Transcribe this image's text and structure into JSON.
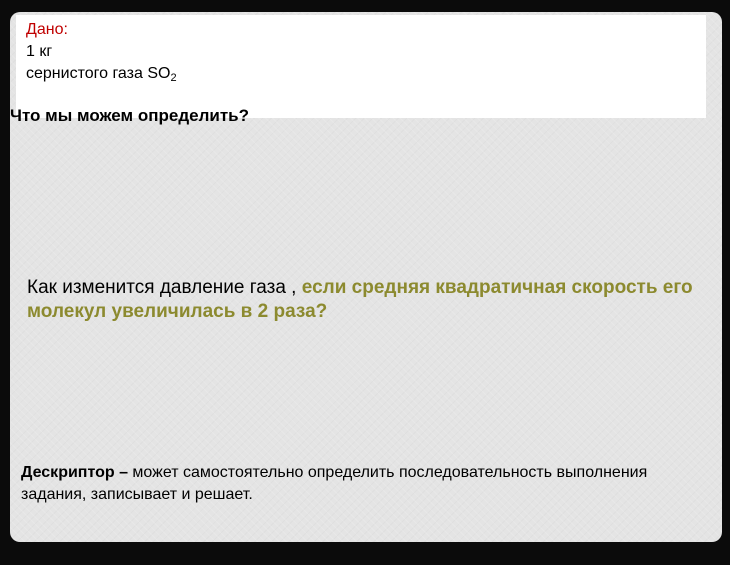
{
  "given": {
    "label": "Дано:",
    "mass": "1 кг",
    "substance_text": "сернистого газа SO",
    "substance_subscript": "2"
  },
  "what_can_we_determine": "Что мы можем определить?",
  "question": {
    "plain": "Как изменится давление газа , ",
    "highlight": "если средняя квадратичная скорость его молекул увеличилась в 2 раза?"
  },
  "descriptor": {
    "term": "Дескриптор –",
    "text": " может самостоятельно  определить последовательность выполнения задания,  записывает и решает."
  },
  "colors": {
    "given_label": "#c00000",
    "question_highlight": "#8c8a2f",
    "slide_background": "#e4e4e4",
    "outer_background": "#0b0b0b"
  }
}
